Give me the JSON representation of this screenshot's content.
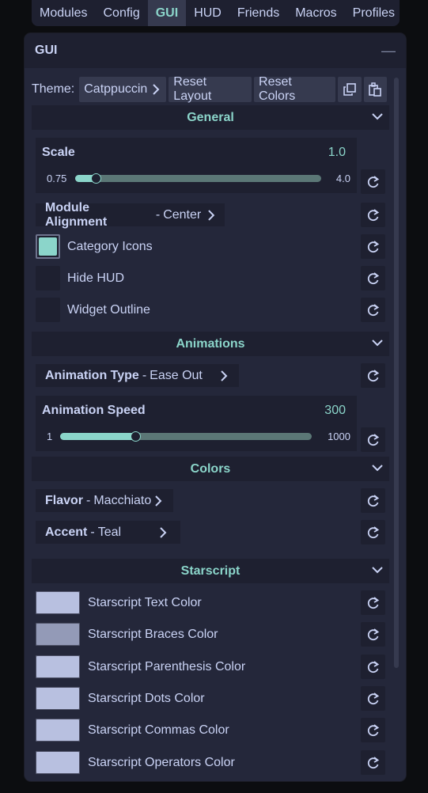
{
  "topbar": {
    "tabs": [
      "Modules",
      "Config",
      "GUI",
      "HUD",
      "Friends",
      "Macros",
      "Profiles"
    ],
    "active": "GUI"
  },
  "window": {
    "title": "GUI",
    "minimize": "—"
  },
  "theme_row": {
    "label": "Theme:",
    "theme_value": "Catppuccin",
    "reset_layout": "Reset Layout",
    "reset_colors": "Reset Colors",
    "copy_icon": "copy-icon",
    "paste_icon": "paste-icon"
  },
  "sections": {
    "general": {
      "title": "General",
      "scale": {
        "name": "Scale",
        "value": "1.0",
        "min": "0.75",
        "max": "4.0",
        "fraction": 0.085
      },
      "module_alignment": {
        "name": "Module Alignment",
        "value": "Center"
      },
      "category_icons": {
        "label": "Category Icons",
        "checked": true
      },
      "hide_hud": {
        "label": "Hide HUD",
        "checked": false
      },
      "widget_outline": {
        "label": "Widget Outline",
        "checked": false
      }
    },
    "animations": {
      "title": "Animations",
      "animation_type": {
        "name": "Animation Type",
        "value": "Ease Out"
      },
      "animation_speed": {
        "name": "Animation Speed",
        "value": "300",
        "min": "1",
        "max": "1000",
        "fraction": 0.3
      }
    },
    "colors": {
      "title": "Colors",
      "flavor": {
        "name": "Flavor",
        "value": "Macchiato"
      },
      "accent": {
        "name": "Accent",
        "value": "Teal"
      }
    },
    "starscript": {
      "title": "Starscript",
      "items": [
        {
          "label": "Starscript Text Color",
          "color": "#b8c0e0"
        },
        {
          "label": "Starscript Braces Color",
          "color": "#939ab7"
        },
        {
          "label": "Starscript Parenthesis Color",
          "color": "#b8c0e0"
        },
        {
          "label": "Starscript Dots Color",
          "color": "#b8c0e0"
        },
        {
          "label": "Starscript Commas Color",
          "color": "#b8c0e0"
        },
        {
          "label": "Starscript Operators Color",
          "color": "#b8c0e0"
        }
      ]
    }
  },
  "colors": {
    "accent": "#8bd5ca",
    "base": "#24273a",
    "mantle": "#1e2030",
    "surface": "#363a4f",
    "text": "#cad3f5"
  }
}
